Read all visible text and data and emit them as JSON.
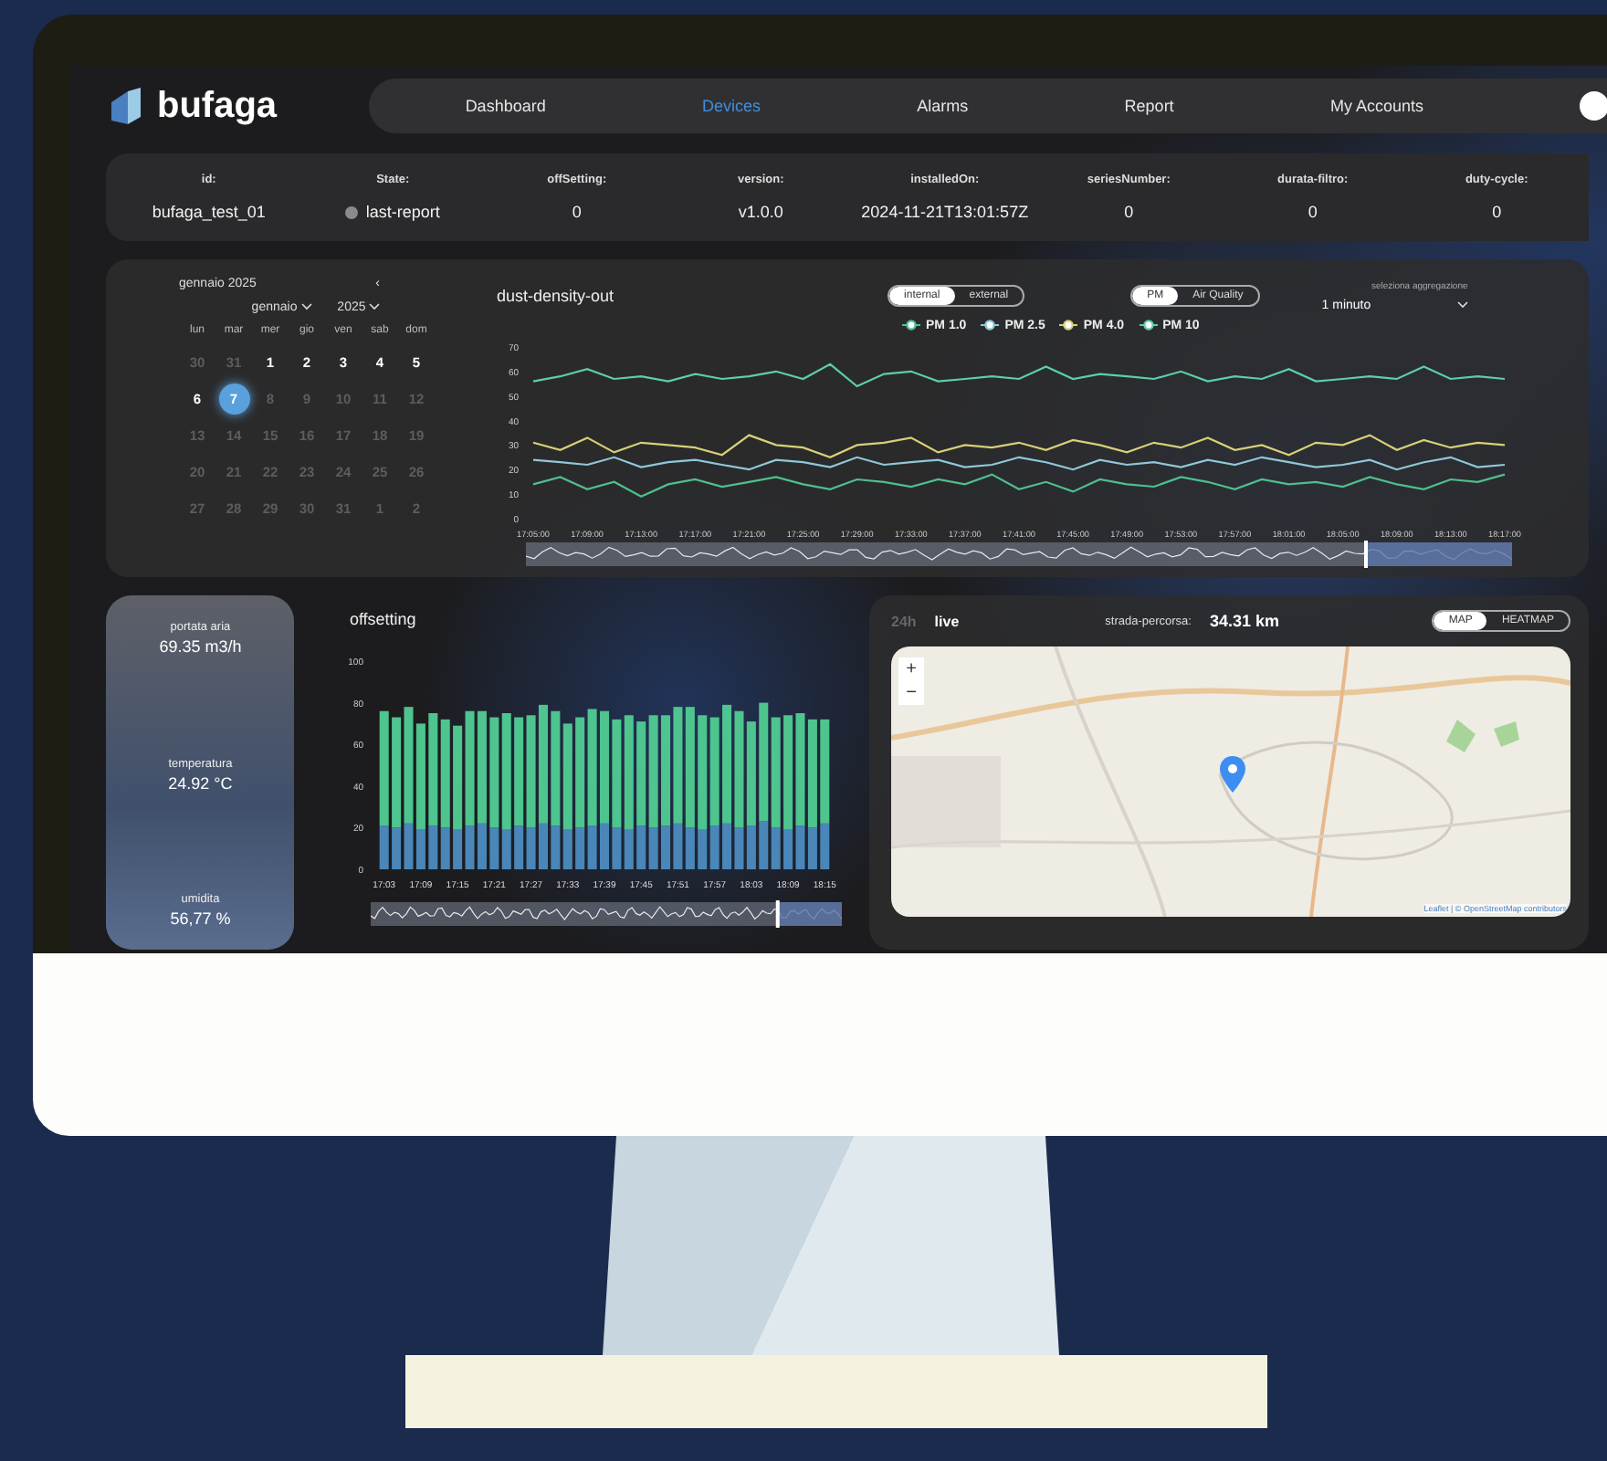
{
  "brand": {
    "name": "bufaga"
  },
  "nav": {
    "tabs": [
      {
        "label": "Dashboard",
        "selected": false
      },
      {
        "label": "Devices",
        "selected": true
      },
      {
        "label": "Alarms",
        "selected": false
      },
      {
        "label": "Report",
        "selected": false
      },
      {
        "label": "My Accounts",
        "selected": false
      }
    ]
  },
  "device_info": [
    {
      "label": "id:",
      "value": "bufaga_test_01",
      "kind": "text"
    },
    {
      "label": "State:",
      "value": "last-report",
      "kind": "status"
    },
    {
      "label": "offSetting:",
      "value": "0",
      "kind": "text"
    },
    {
      "label": "version:",
      "value": "v1.0.0",
      "kind": "text"
    },
    {
      "label": "installedOn:",
      "value": "2024-11-21T13:01:57Z",
      "kind": "text"
    },
    {
      "label": "seriesNumber:",
      "value": "0",
      "kind": "text"
    },
    {
      "label": "durata-filtro:",
      "value": "0",
      "kind": "text"
    },
    {
      "label": "duty-cycle:",
      "value": "0",
      "kind": "text"
    }
  ],
  "calendar": {
    "title": "gennaio 2025",
    "prev": "‹",
    "month": "gennaio",
    "year": "2025",
    "weekdays": [
      "lun",
      "mar",
      "mer",
      "gio",
      "ven",
      "sab",
      "dom"
    ],
    "weeks": [
      [
        {
          "label": "30",
          "selected": false,
          "disabled": true
        },
        {
          "label": "31",
          "selected": false,
          "disabled": true
        },
        {
          "label": "1",
          "selected": false,
          "disabled": false
        },
        {
          "label": "2",
          "selected": false,
          "disabled": false
        },
        {
          "label": "3",
          "selected": false,
          "disabled": false
        },
        {
          "label": "4",
          "selected": false,
          "disabled": false
        },
        {
          "label": "5",
          "selected": false,
          "disabled": false
        }
      ],
      [
        {
          "label": "6",
          "selected": false,
          "disabled": false
        },
        {
          "label": "7",
          "selected": true,
          "disabled": false
        },
        {
          "label": "8",
          "selected": false,
          "disabled": true
        },
        {
          "label": "9",
          "selected": false,
          "disabled": true
        },
        {
          "label": "10",
          "selected": false,
          "disabled": true
        },
        {
          "label": "11",
          "selected": false,
          "disabled": true
        },
        {
          "label": "12",
          "selected": false,
          "disabled": true
        }
      ],
      [
        {
          "label": "13",
          "selected": false,
          "disabled": true
        },
        {
          "label": "14",
          "selected": false,
          "disabled": true
        },
        {
          "label": "15",
          "selected": false,
          "disabled": true
        },
        {
          "label": "16",
          "selected": false,
          "disabled": true
        },
        {
          "label": "17",
          "selected": false,
          "disabled": true
        },
        {
          "label": "18",
          "selected": false,
          "disabled": true
        },
        {
          "label": "19",
          "selected": false,
          "disabled": true
        }
      ],
      [
        {
          "label": "20",
          "selected": false,
          "disabled": true
        },
        {
          "label": "21",
          "selected": false,
          "disabled": true
        },
        {
          "label": "22",
          "selected": false,
          "disabled": true
        },
        {
          "label": "23",
          "selected": false,
          "disabled": true
        },
        {
          "label": "24",
          "selected": false,
          "disabled": true
        },
        {
          "label": "25",
          "selected": false,
          "disabled": true
        },
        {
          "label": "26",
          "selected": false,
          "disabled": true
        }
      ],
      [
        {
          "label": "27",
          "selected": false,
          "disabled": true
        },
        {
          "label": "28",
          "selected": false,
          "disabled": true
        },
        {
          "label": "29",
          "selected": false,
          "disabled": true
        },
        {
          "label": "30",
          "selected": false,
          "disabled": true
        },
        {
          "label": "31",
          "selected": false,
          "disabled": true
        },
        {
          "label": "1",
          "selected": false,
          "disabled": true
        },
        {
          "label": "2",
          "selected": false,
          "disabled": true
        }
      ]
    ]
  },
  "dust_chart": {
    "title": "dust-density-out",
    "source_toggle": [
      {
        "label": "internal",
        "selected": true
      },
      {
        "label": "external",
        "selected": false
      }
    ],
    "type_toggle": [
      {
        "label": "PM",
        "selected": true
      },
      {
        "label": "Air Quality",
        "selected": false
      }
    ],
    "aggregation": {
      "label": "seleziona aggregazione",
      "value": "1 minuto"
    },
    "range_slider": {
      "level": 0.15
    },
    "chart_data": {
      "type": "line",
      "categories": [
        "17:05:00",
        null,
        "17:09:00",
        null,
        "17:13:00",
        null,
        "17:17:00",
        null,
        "17:21:00",
        null,
        "17:25:00",
        null,
        "17:29:00",
        null,
        "17:33:00",
        null,
        "17:37:00",
        null,
        "17:41:00",
        null,
        "17:45:00",
        null,
        "17:49:00",
        null,
        "17:53:00",
        null,
        "17:57:00",
        null,
        "18:01:00",
        null,
        "18:05:00",
        null,
        "18:09:00",
        null,
        "18:13:00",
        null,
        "18:17:00"
      ],
      "ylim": [
        0,
        70
      ],
      "yticks": [
        0,
        10,
        20,
        30,
        40,
        50,
        60,
        70
      ],
      "series": [
        {
          "name": "PM 1.0",
          "color": "#4fbf8f",
          "values": [
            14,
            17,
            12,
            15,
            9,
            14,
            16,
            13,
            15,
            17,
            14,
            12,
            16,
            15,
            13,
            16,
            14,
            18,
            12,
            15,
            11,
            16,
            14,
            13,
            17,
            15,
            12,
            16,
            14,
            15,
            13,
            17,
            14,
            12,
            16,
            15,
            18
          ]
        },
        {
          "name": "PM 2.5",
          "color": "#8fc8d8",
          "values": [
            24,
            23,
            22,
            25,
            21,
            23,
            24,
            22,
            20,
            24,
            23,
            21,
            25,
            22,
            23,
            24,
            21,
            22,
            25,
            23,
            20,
            24,
            22,
            23,
            21,
            24,
            22,
            25,
            23,
            21,
            22,
            24,
            20,
            23,
            25,
            21,
            22
          ]
        },
        {
          "name": "PM 4.0",
          "color": "#d8cf78",
          "values": [
            31,
            28,
            33,
            27,
            31,
            30,
            29,
            26,
            34,
            30,
            29,
            25,
            30,
            31,
            33,
            27,
            30,
            29,
            31,
            28,
            32,
            30,
            27,
            31,
            29,
            33,
            28,
            30,
            26,
            31,
            30,
            34,
            28,
            32,
            29,
            31,
            30
          ]
        },
        {
          "name": "PM 10",
          "color": "#5ccfa8",
          "values": [
            56,
            58,
            61,
            57,
            58,
            56,
            59,
            57,
            58,
            60,
            57,
            63,
            54,
            59,
            60,
            56,
            57,
            58,
            57,
            62,
            57,
            59,
            58,
            57,
            60,
            56,
            58,
            57,
            61,
            56,
            57,
            58,
            57,
            62,
            57,
            58,
            57
          ]
        }
      ]
    }
  },
  "stats": [
    {
      "label": "portata aria",
      "value": "69.35 m3/h"
    },
    {
      "label": "temperatura",
      "value": "24.92 °C"
    },
    {
      "label": "umidita",
      "value": "56,77 %"
    }
  ],
  "offsetting_chart": {
    "title": "offsetting",
    "range_slider": {
      "level": 0.14
    },
    "chart_data": {
      "type": "bar",
      "stacked": true,
      "categories": [
        "17:03",
        null,
        null,
        "17:09",
        null,
        null,
        "17:15",
        null,
        null,
        "17:21",
        null,
        null,
        "17:27",
        null,
        null,
        "17:33",
        null,
        null,
        "17:39",
        null,
        null,
        "17:45",
        null,
        null,
        "17:51",
        null,
        null,
        "17:57",
        null,
        null,
        "18:03",
        null,
        null,
        "18:09",
        null,
        null,
        "18:15"
      ],
      "ylim": [
        0,
        100
      ],
      "yticks": [
        0,
        20,
        40,
        60,
        80,
        100
      ],
      "series": [
        {
          "color": "#4a86b8",
          "values": [
            21,
            20,
            22,
            19,
            21,
            20,
            19,
            21,
            22,
            20,
            19,
            21,
            20,
            22,
            21,
            19,
            20,
            21,
            22,
            20,
            19,
            21,
            20,
            21,
            22,
            20,
            19,
            21,
            22,
            20,
            21,
            23,
            20,
            19,
            21,
            20,
            22
          ]
        },
        {
          "color": "#4ec48e",
          "values": [
            55,
            53,
            56,
            51,
            54,
            52,
            50,
            55,
            54,
            53,
            56,
            52,
            54,
            57,
            55,
            51,
            53,
            56,
            54,
            52,
            55,
            50,
            54,
            53,
            56,
            58,
            55,
            52,
            57,
            56,
            50,
            57,
            53,
            55,
            54,
            52,
            50
          ]
        }
      ]
    }
  },
  "map_panel": {
    "range_tabs": [
      {
        "label": "24h",
        "selected": false
      },
      {
        "label": "live",
        "selected": true
      }
    ],
    "distance_label": "strada-percorsa:",
    "distance_value": "34.31 km",
    "view_toggle": [
      {
        "label": "MAP",
        "selected": true
      },
      {
        "label": "HEATMAP",
        "selected": false
      }
    ],
    "zoom_in": "+",
    "zoom_out": "−",
    "attribution": "Leaflet | © OpenStreetMap contributors"
  }
}
